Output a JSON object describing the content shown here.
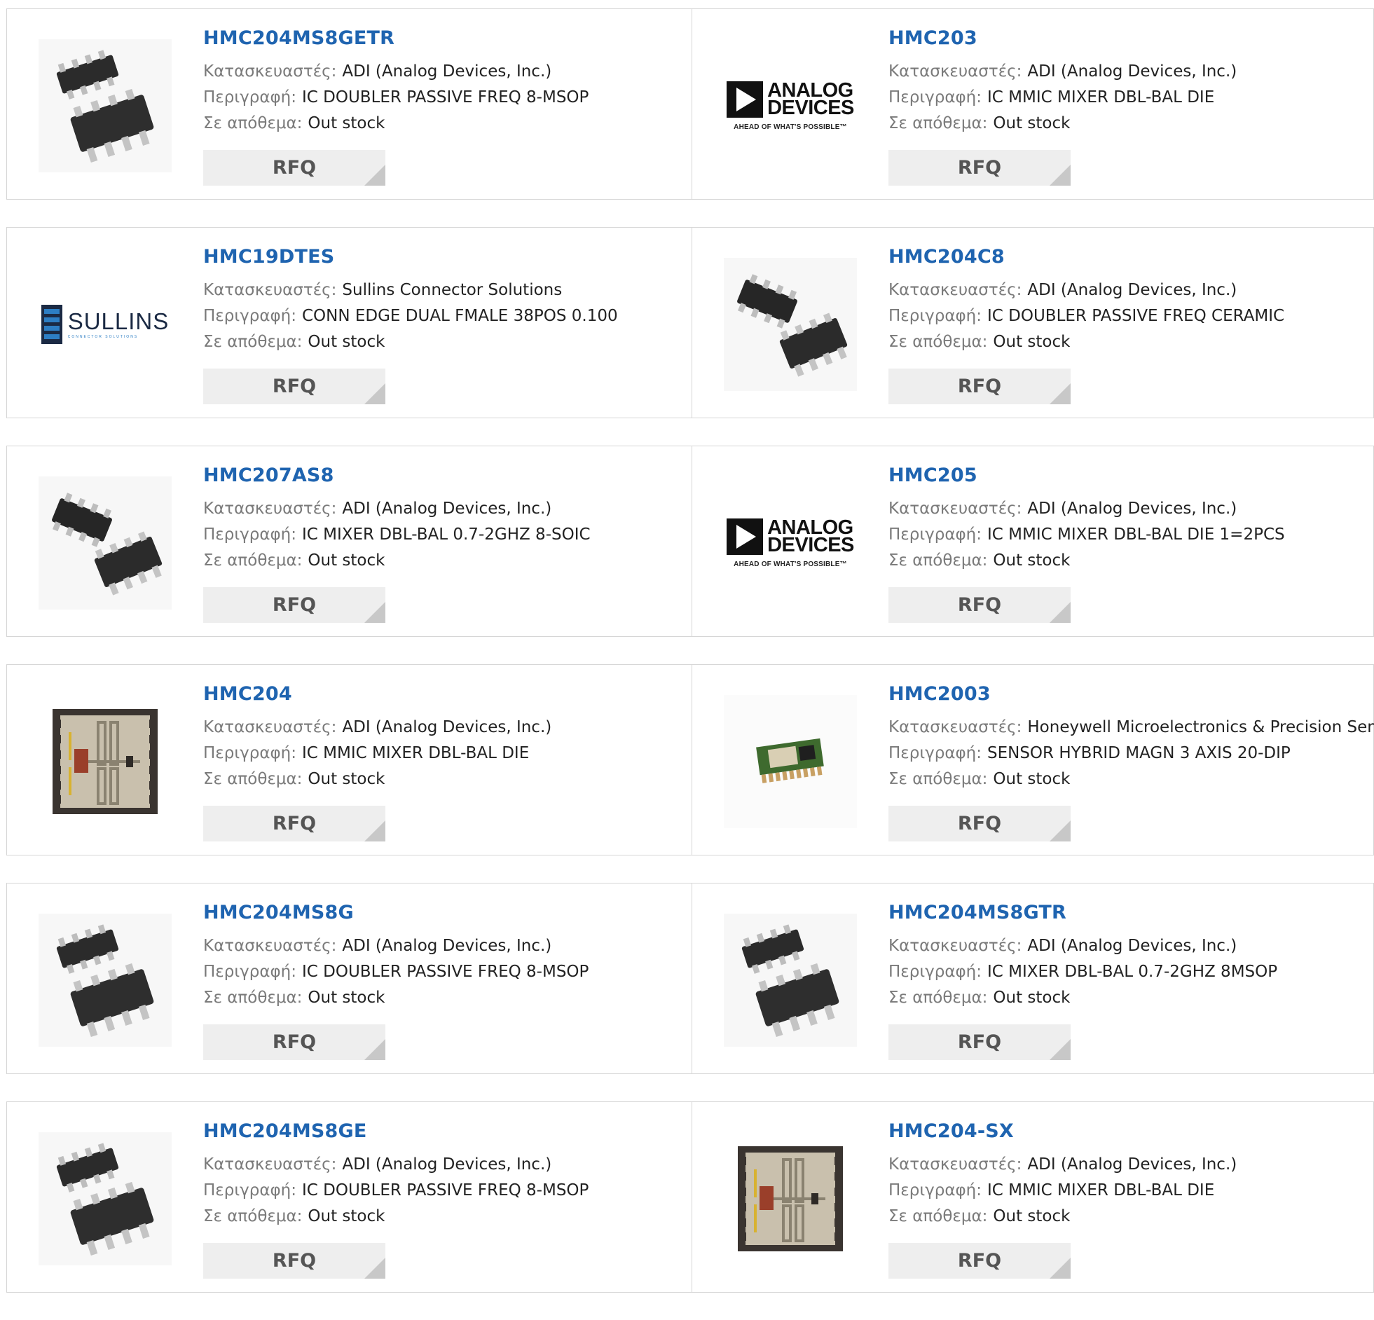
{
  "labels": {
    "manufacturer": "Κατασκευαστές:",
    "description": "Περιγραφή:",
    "stock": "Σε απόθεμα:",
    "rfq": "RFQ"
  },
  "logos": {
    "analog": {
      "line1": "ANALOG",
      "line2": "DEVICES",
      "tagline": "AHEAD OF WHAT'S POSSIBLE™"
    },
    "sullins": {
      "name": "SULLINS",
      "tagline": "CONNECTOR SOLUTIONS"
    }
  },
  "products": [
    {
      "part": "HMC204MS8GETR",
      "manufacturer": "ADI (Analog Devices, Inc.)",
      "description": "IC DOUBLER PASSIVE FREQ 8-MSOP",
      "stock": "Out stock",
      "image": "msop-chip-icon"
    },
    {
      "part": "HMC203",
      "manufacturer": "ADI (Analog Devices, Inc.)",
      "description": "IC MMIC MIXER DBL-BAL DIE",
      "stock": "Out stock",
      "image": "analog-devices-logo"
    },
    {
      "part": "HMC19DTES",
      "manufacturer": "Sullins Connector Solutions",
      "description": "CONN EDGE DUAL FMALE 38POS 0.100",
      "stock": "Out stock",
      "image": "sullins-logo"
    },
    {
      "part": "HMC204C8",
      "manufacturer": "ADI (Analog Devices, Inc.)",
      "description": "IC DOUBLER PASSIVE FREQ CERAMIC",
      "stock": "Out stock",
      "image": "soic-chip-icon"
    },
    {
      "part": "HMC207AS8",
      "manufacturer": "ADI (Analog Devices, Inc.)",
      "description": "IC MIXER DBL-BAL 0.7-2GHZ 8-SOIC",
      "stock": "Out stock",
      "image": "soic-chip-icon"
    },
    {
      "part": "HMC205",
      "manufacturer": "ADI (Analog Devices, Inc.)",
      "description": "IC MMIC MIXER DBL-BAL DIE 1=2PCS",
      "stock": "Out stock",
      "image": "analog-devices-logo"
    },
    {
      "part": "HMC204",
      "manufacturer": "ADI (Analog Devices, Inc.)",
      "description": "IC MMIC MIXER DBL-BAL DIE",
      "stock": "Out stock",
      "image": "die-chip-icon"
    },
    {
      "part": "HMC2003",
      "manufacturer": "Honeywell Microelectronics & Precision Sensors",
      "description": "SENSOR HYBRID MAGN 3 AXIS 20-DIP",
      "stock": "Out stock",
      "image": "sensor-module-icon"
    },
    {
      "part": "HMC204MS8G",
      "manufacturer": "ADI (Analog Devices, Inc.)",
      "description": "IC DOUBLER PASSIVE FREQ 8-MSOP",
      "stock": "Out stock",
      "image": "msop-chip-icon"
    },
    {
      "part": "HMC204MS8GTR",
      "manufacturer": "ADI (Analog Devices, Inc.)",
      "description": "IC MIXER DBL-BAL 0.7-2GHZ 8MSOP",
      "stock": "Out stock",
      "image": "msop-chip-icon"
    },
    {
      "part": "HMC204MS8GE",
      "manufacturer": "ADI (Analog Devices, Inc.)",
      "description": "IC DOUBLER PASSIVE FREQ 8-MSOP",
      "stock": "Out stock",
      "image": "msop-chip-icon"
    },
    {
      "part": "HMC204-SX",
      "manufacturer": "ADI (Analog Devices, Inc.)",
      "description": "IC MMIC MIXER DBL-BAL DIE",
      "stock": "Out stock",
      "image": "die-chip-icon"
    }
  ]
}
